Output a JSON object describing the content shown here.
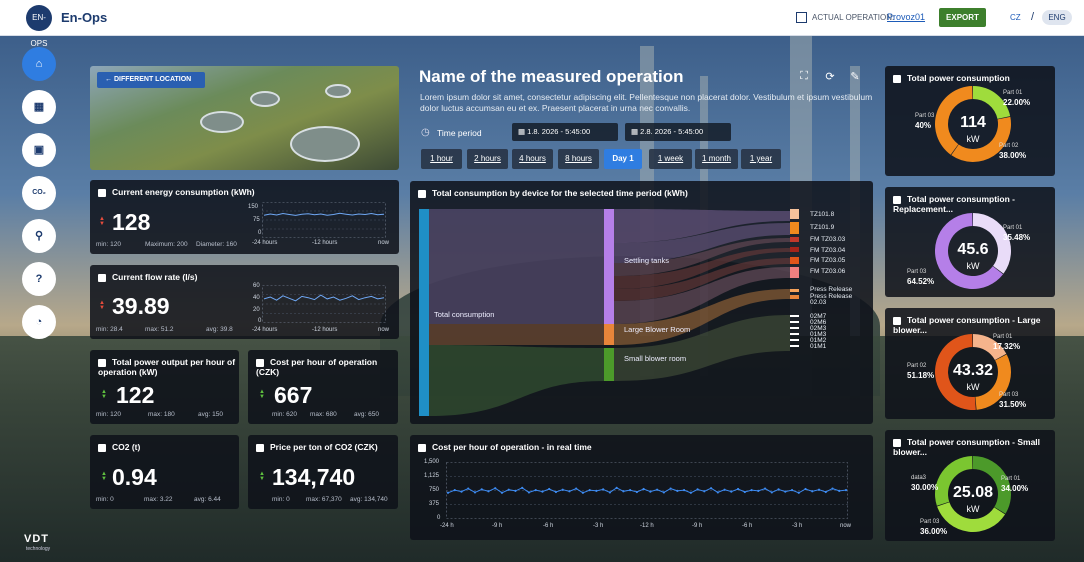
{
  "topbar": {
    "app_name": "En-Ops",
    "logo_text": "EN-OPS",
    "actual_operation_label": "ACTUAL OPERATION:",
    "actual_operation_value": "Provoz01",
    "export_label": "EXPORT",
    "lang_cz": "CZ",
    "lang_sep": "/",
    "lang_eng": "ENG"
  },
  "sidenav": {
    "items": [
      {
        "name": "home",
        "glyph": "⌂"
      },
      {
        "name": "calendar",
        "glyph": "▦"
      },
      {
        "name": "schedule",
        "glyph": "▣"
      },
      {
        "name": "co2",
        "glyph": "CO₂"
      },
      {
        "name": "satellite",
        "glyph": "⚲"
      },
      {
        "name": "help",
        "glyph": "?"
      },
      {
        "name": "gauge",
        "glyph": "◔"
      }
    ],
    "brand": "VDT",
    "brand_sub": "technology"
  },
  "location": {
    "button_label": "DIFFERENT LOCATION",
    "arrow": "←"
  },
  "operation": {
    "title": "Name of the measured operation",
    "description": "Lorem ipsum dolor sit amet, consectetur adipiscing elit. Pellentesque non placerat dolor. Vestibulum et ipsum vestibulum dolor luctus accumsan eu et ex. Praesent placerat in urna nec convallis.",
    "time_period_label": "Time period",
    "date_from": "1.8. 2026 - 5:45:00",
    "date_to": "2.8. 2026 - 5:45:00",
    "ranges": [
      "1 hour",
      "2 hours",
      "4 hours",
      "8 hours",
      "Day 1",
      "1 week",
      "1 month",
      "1 year"
    ],
    "active_range": "Day 1"
  },
  "energy": {
    "title": "Current energy consumption (kWh)",
    "value": "128",
    "min": "min: 120",
    "max": "Maximum: 200",
    "extra": "Diameter: 160",
    "yticks": [
      "150",
      "75",
      "0"
    ],
    "xticks": [
      "-24 hours",
      "-12 hours",
      "now"
    ]
  },
  "flow": {
    "title": "Current flow rate (l/s)",
    "value": "39.89",
    "min": "min: 28.4",
    "max": "max: 51.2",
    "avg": "avg: 39.8",
    "yticks": [
      "60",
      "40",
      "20",
      "0"
    ],
    "xticks": [
      "-24 hours",
      "-12 hours",
      "now"
    ]
  },
  "power_output": {
    "title": "Total power output per hour of operation (kW)",
    "value": "122",
    "min": "min: 120",
    "max": "max: 180",
    "avg": "avg: 150"
  },
  "cost_hour": {
    "title": "Cost per hour of operation (CZK)",
    "value": "667",
    "min": "min: 620",
    "max": "max: 680",
    "avg": "avg: 650"
  },
  "co2": {
    "title": "CO2 (t)",
    "value": "0.94",
    "min": "min: 0",
    "max": "max: 3.22",
    "avg": "avg: 6.44"
  },
  "co2_price": {
    "title": "Price per ton of CO2 (CZK)",
    "value": "134,740",
    "min": "min: 0",
    "max": "max: 67,370",
    "avg": "avg: 134,740"
  },
  "sankey": {
    "title": "Total consumption by device for the selected time period (kWh)",
    "source": "Total consumption",
    "groups": [
      "Settling tanks",
      "Large Blower Room",
      "Small blower room"
    ],
    "devices": [
      "TZ101.8",
      "TZ101.9",
      "FM TZ03.03",
      "FM TZ03.04",
      "FM TZ03.05",
      "FM TZ03.06",
      "Press Release",
      "Press Release",
      "02.03",
      "02M7",
      "02M6",
      "02M3",
      "01M3",
      "01M2",
      "01M1"
    ],
    "colors": {
      "total": "#1f8fc6",
      "settling": "#b57fe8",
      "large": "#e8853a",
      "small": "#4c9a2a"
    }
  },
  "realtime": {
    "title": "Cost per hour of operation - in real time",
    "yticks": [
      "1,500",
      "1,125",
      "750",
      "375",
      "0"
    ],
    "xticks": [
      "-24 h",
      "-9 h",
      "-6 h",
      "-3 h",
      "-12 h",
      "-9 h",
      "-6 h",
      "-3 h",
      "now"
    ]
  },
  "donuts": [
    {
      "title": "Total power consumption",
      "value": "114",
      "unit": "kW",
      "parts": [
        {
          "label": "Part 01",
          "pct": "22.00%",
          "color": "#9fdc3c",
          "frac": 0.22
        },
        {
          "label": "Part 02",
          "pct": "38.00%",
          "color": "#f08a1e",
          "frac": 0.38
        },
        {
          "label": "Part 03",
          "pct": "40%",
          "color": "#f08a1e",
          "frac": 0.4
        }
      ]
    },
    {
      "title": "Total power consumption - Replacement...",
      "value": "45.6",
      "unit": "kW",
      "parts": [
        {
          "label": "Part 01",
          "pct": "35.48%",
          "color": "#e9dcf8",
          "frac": 0.3548
        },
        {
          "label": "Part 03",
          "pct": "64.52%",
          "color": "#b57fe8",
          "frac": 0.6452
        }
      ]
    },
    {
      "title": "Total power consumption - Large blower...",
      "value": "43.32",
      "unit": "kW",
      "parts": [
        {
          "label": "Part 01",
          "pct": "17.32%",
          "color": "#f5b48c",
          "frac": 0.1732
        },
        {
          "label": "Part 03",
          "pct": "31.50%",
          "color": "#f08a1e",
          "frac": 0.315
        },
        {
          "label": "Part 02",
          "pct": "51.18%",
          "color": "#e0551a",
          "frac": 0.5118
        }
      ]
    },
    {
      "title": "Total power consumption - Small blower...",
      "value": "25.08",
      "unit": "kW",
      "parts": [
        {
          "label": "Part 01",
          "pct": "34.00%",
          "color": "#4c9a2a",
          "frac": 0.34
        },
        {
          "label": "Part 03",
          "pct": "36.00%",
          "color": "#9fdc3c",
          "frac": 0.36
        },
        {
          "label": "data3",
          "pct": "30.00%",
          "color": "#7bc630",
          "frac": 0.3
        }
      ]
    }
  ],
  "chart_data": [
    {
      "type": "line",
      "title": "Current energy consumption (kWh)",
      "x": [
        "-24 hours",
        "-12 hours",
        "now"
      ],
      "ylim": [
        0,
        150
      ],
      "series": [
        {
          "values": [
            95,
            100,
            96,
            102,
            98,
            94,
            99,
            101,
            97,
            100,
            95,
            98,
            103,
            99,
            96,
            100,
            98,
            102,
            97,
            99
          ]
        }
      ]
    },
    {
      "type": "line",
      "title": "Current flow rate (l/s)",
      "x": [
        "-24 hours",
        "-12 hours",
        "now"
      ],
      "ylim": [
        0,
        60
      ],
      "series": [
        {
          "values": [
            38,
            41,
            36,
            43,
            39,
            35,
            42,
            40,
            37,
            44,
            38,
            41,
            36,
            39,
            43,
            37,
            40,
            42,
            38,
            40
          ]
        }
      ]
    },
    {
      "type": "line",
      "title": "Cost per hour of operation - in real time",
      "x": [
        "-24 h",
        "-9 h",
        "-6 h",
        "-3 h",
        "-12 h",
        "-9 h",
        "-6 h",
        "-3 h",
        "now"
      ],
      "ylim": [
        0,
        1500
      ],
      "series": [
        {
          "values": [
            690,
            760,
            720,
            800,
            700,
            780,
            730,
            810,
            690,
            770,
            740,
            820,
            700,
            760,
            720,
            790,
            710,
            770,
            730,
            800,
            690,
            760,
            740,
            780,
            700,
            820,
            730,
            760,
            710,
            790,
            720,
            770,
            700,
            800,
            740,
            760,
            690,
            780,
            730,
            810,
            700,
            770,
            720,
            790,
            710,
            760,
            740,
            800,
            700,
            780,
            720,
            760,
            690,
            790,
            730,
            770,
            710,
            800,
            740,
            760
          ]
        }
      ]
    },
    {
      "type": "pie",
      "title": "Total power consumption",
      "categories": [
        "Part 01",
        "Part 02",
        "Part 03"
      ],
      "values": [
        22,
        38,
        40
      ]
    },
    {
      "type": "pie",
      "title": "Total power consumption - Replacement...",
      "categories": [
        "Part 01",
        "Part 03"
      ],
      "values": [
        35.48,
        64.52
      ]
    },
    {
      "type": "pie",
      "title": "Total power consumption - Large blower...",
      "categories": [
        "Part 01",
        "Part 02",
        "Part 03"
      ],
      "values": [
        17.32,
        51.18,
        31.5
      ]
    },
    {
      "type": "pie",
      "title": "Total power consumption - Small blower...",
      "categories": [
        "Part 01",
        "Part 03",
        "data3"
      ],
      "values": [
        34,
        36,
        30
      ]
    }
  ]
}
